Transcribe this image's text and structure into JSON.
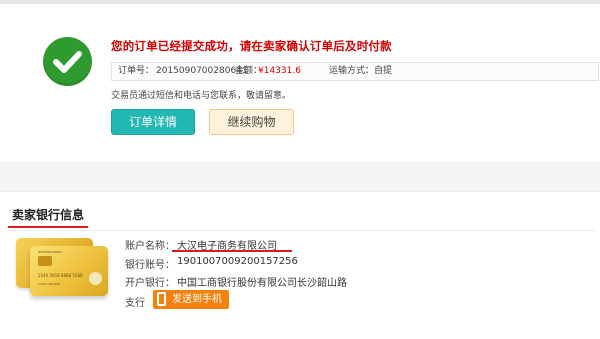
{
  "success": {
    "message": "您的订单已经提交成功，请在卖家确认订单后及时付款"
  },
  "order": {
    "number_label": "订单号：",
    "number": "2015090700280641",
    "amount_label": "金额：",
    "amount": "¥14331.6",
    "shipping_label": "运输方式：",
    "shipping": "自提"
  },
  "note": "交易员通过短信和电话与您联系，敬请留意。",
  "buttons": {
    "details": "订单详情",
    "continue": "继续购物"
  },
  "bank": {
    "title": "卖家银行信息",
    "account_name_label": "账户名称：",
    "account_name": "大汉电子商务有限公司",
    "account_no_label": "银行账号：",
    "account_no": "1901007009200157256",
    "bank_label": "开户银行：",
    "bank_name": "中国工商银行股份有限公司长沙韶山路",
    "pay_label": "支行",
    "send_button": "发送到手机"
  },
  "card": {
    "brand": "INTERNATIONAL",
    "number": "2540 5658 8888 5588",
    "holder": "CARD HOLDER"
  },
  "colors": {
    "success": "#2f9a2f",
    "alert_red": "#d60000",
    "teal": "#22b7b2",
    "orange": "#f5820f"
  }
}
